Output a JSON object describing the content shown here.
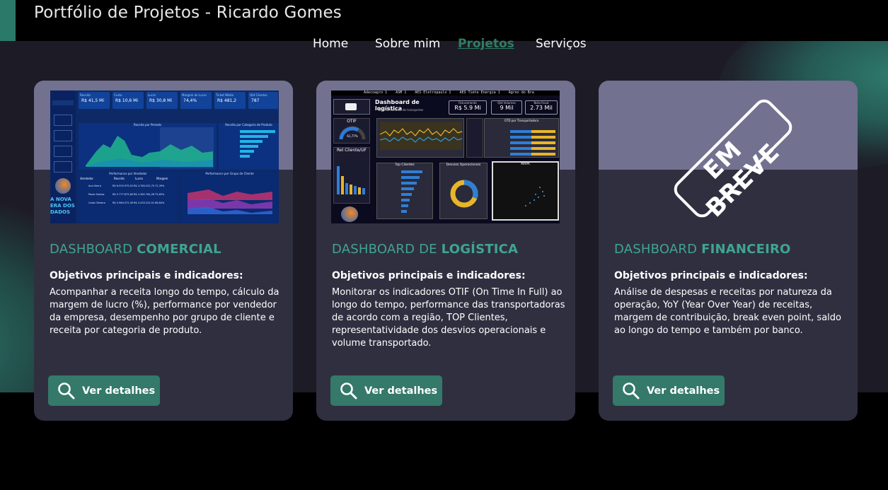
{
  "header": {
    "title": "Portfólio de Projetos - Ricardo Gomes"
  },
  "nav": {
    "items": [
      {
        "label": "Home",
        "active": false
      },
      {
        "label": "Sobre mim",
        "active": false
      },
      {
        "label": "Projetos",
        "active": true
      },
      {
        "label": "Serviços",
        "active": false
      }
    ]
  },
  "colors": {
    "accent": "#2f7d63",
    "card_bg": "#302f40",
    "button_bg": "#34796a",
    "title_color": "#3fa58f"
  },
  "cards": [
    {
      "title_prefix": "DASHBOARD ",
      "title_bold": "COMERCIAL",
      "subtitle": "Objetivos principais e indicadores:",
      "description": "Acompanhar a receita longo do tempo, cálculo da margem de lucro (%), performance por vendedor da empresa, desempenho por grupo de cliente e receita por categoria de produto.",
      "button_label": "Ver detalhes",
      "button_icon": "search-icon",
      "thumbnail": {
        "kpis": [
          {
            "label": "Receita",
            "value": "R$ 41,5 Mi"
          },
          {
            "label": "Custo",
            "value": "R$ 10,6 Mi"
          },
          {
            "label": "Lucro",
            "value": "R$ 30,8 Mi"
          },
          {
            "label": "Margem de Lucro",
            "value": "74,4%"
          },
          {
            "label": "Ticket Médio",
            "value": "R$ 481,2"
          },
          {
            "label": "Qtd Clientes",
            "value": "787"
          }
        ],
        "chart_title": "Receita por Período",
        "side_title": "Receita por Categoria de Produto",
        "table_title": "Performance por Vendedor",
        "group_title": "Performance por Grupo de Cliente",
        "table_headers": [
          "Vendedor",
          "Receita",
          "Lucro",
          "Margem"
        ],
        "rows": [
          [
            "Ana Vieira",
            "R$ 6.525.975,52",
            "R$ 4.789.252,70",
            "72,39%"
          ],
          [
            "Paulo Santos",
            "R$ 5.777.875,80",
            "R$ 4.382.764,28",
            "75,85%"
          ],
          [
            "Carla Oliveira",
            "R$ 5.964.572,49",
            "R$ 4.435.224,51",
            "66,84%"
          ]
        ],
        "banner": "A NOVA ERA DOS DADOS"
      }
    },
    {
      "title_prefix": "DASHBOARD DE ",
      "title_bold": "LOGÍSTICA",
      "subtitle": "Objetivos principais e indicadores:",
      "description": "Monitorar os indicadores OTIF (On Time In Full) ao longo do tempo, performance das transportadoras de acordo com a região, TOP Clientes, representatividade dos desvios operacionais e volume transportado.",
      "button_label": "Ver detalhes",
      "button_icon": "search-icon",
      "thumbnail": {
        "ticker": "Adecoagro 1    ASM 1    AES Eletropaulo 1    AES Tiete Energia 1    Agrex do Bra",
        "title": "Dashboard de logística",
        "subtitle": "Torre de controle de transportes",
        "kpis": [
          {
            "label": "Faturamento",
            "value": "R$ 5.9 Mi"
          },
          {
            "label": "Qtd Volumes",
            "value": "9 Mil"
          },
          {
            "label": "Nota fiscal",
            "value": "2.73 Mil"
          }
        ],
        "otif_label": "OTIF",
        "otif_value": "61,77%",
        "rel_label": "Rel Cliente/UF",
        "top_clients_title": "Top Clientes",
        "desvios_title": "Desvios Operacionais",
        "mapa_title": "MAPA",
        "otd_title": "OTD por Transportadora"
      }
    },
    {
      "title_prefix": "DASHBOARD ",
      "title_bold": "FINANCEIRO",
      "subtitle": "Objetivos principais e indicadores:",
      "description": "Análise de despesas e receitas por natureza da operação, YoY (Year Over Year) de receitas, margem de contribuição, break even point, saldo ao longo do tempo e também por banco.",
      "button_label": "Ver detalhes",
      "button_icon": "search-icon",
      "stamp": "EM BREVE"
    }
  ]
}
